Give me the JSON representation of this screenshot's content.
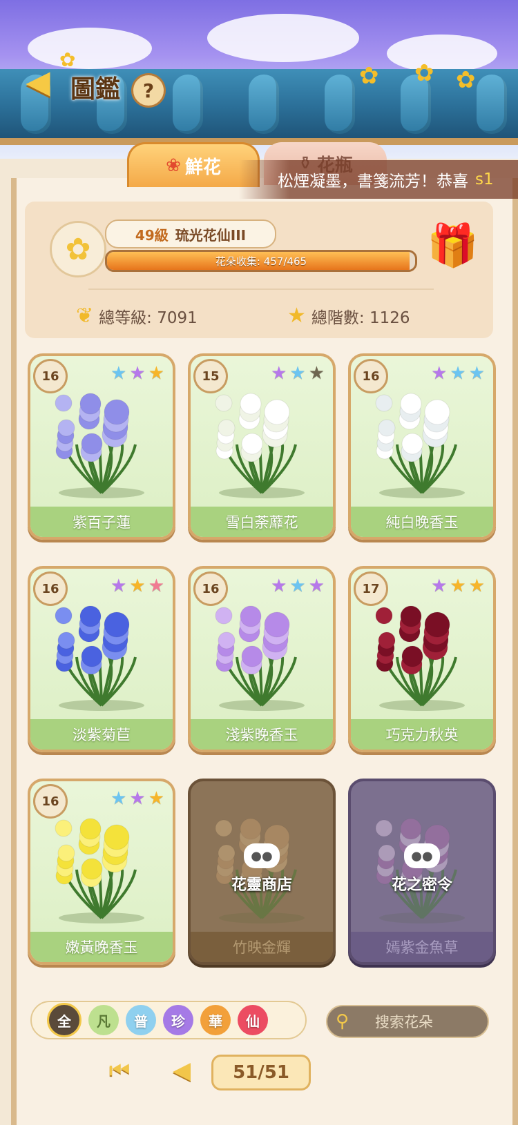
{
  "header": {
    "title": "圖鑑",
    "help_label": "?",
    "back_icon": "back-arrow-icon"
  },
  "tabs": [
    {
      "label": "鮮花",
      "icon": "rose-icon",
      "active": true
    },
    {
      "label": "花瓶",
      "icon": "vase-icon",
      "active": false
    }
  ],
  "ticker": {
    "text": "松煙凝墨，書箋流芳！恭喜",
    "highlight": "s1"
  },
  "stats": {
    "level": "49級",
    "rank_title": "琉光花仙III",
    "collection_label": "花朵收集: 457/465",
    "collection_fraction": 0.983,
    "total_level": "總等級: 7091",
    "total_stars": "總階數: 1126"
  },
  "colors": {
    "star_blue": "#6cc4f0",
    "star_purple": "#b678ea",
    "star_gold": "#f6b52a",
    "star_pink": "#f07a92",
    "star_dark": "#6e6650"
  },
  "cards": [
    {
      "level": "16",
      "name": "紫百子蓮",
      "stars": [
        "blue",
        "purple",
        "gold"
      ]
    },
    {
      "level": "15",
      "name": "雪白荼蘼花",
      "stars": [
        "purple",
        "blue",
        "dark"
      ]
    },
    {
      "level": "16",
      "name": "純白晚香玉",
      "stars": [
        "purple",
        "blue",
        "blue"
      ]
    },
    {
      "level": "16",
      "name": "淡紫菊苣",
      "stars": [
        "purple",
        "gold",
        "pink"
      ]
    },
    {
      "level": "16",
      "name": "淺紫晚香玉",
      "stars": [
        "purple",
        "blue",
        "purple"
      ]
    },
    {
      "level": "17",
      "name": "巧克力秋英",
      "stars": [
        "purple",
        "gold",
        "gold"
      ]
    },
    {
      "level": "16",
      "name": "嫩黃晚香玉",
      "stars": [
        "blue",
        "purple",
        "gold"
      ]
    },
    {
      "name": "竹映金輝",
      "locked_label": "花靈商店"
    },
    {
      "name": "嫣紫金魚草",
      "locked_label": "花之密令"
    }
  ],
  "filters": [
    "全",
    "凡",
    "普",
    "珍",
    "華",
    "仙"
  ],
  "search": {
    "placeholder": "搜索花朵"
  },
  "pager": {
    "current": "51/51"
  }
}
